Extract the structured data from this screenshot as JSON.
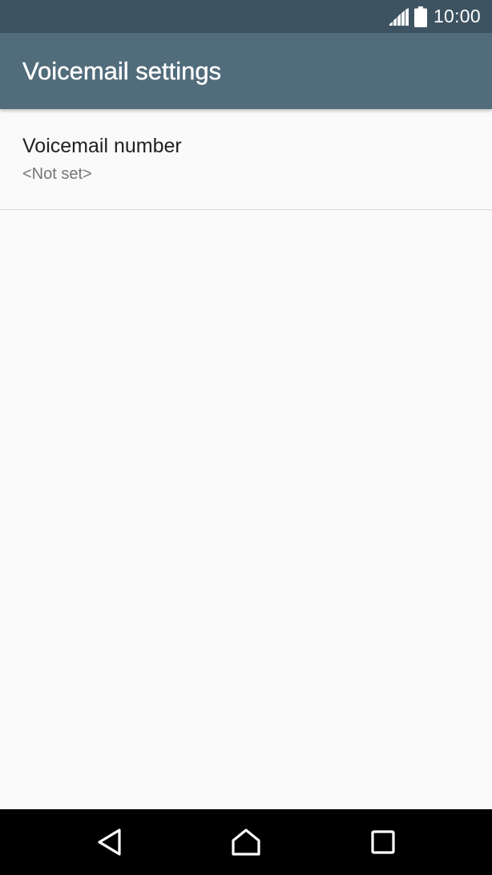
{
  "status_bar": {
    "time": "10:00",
    "icons": [
      "signal-icon",
      "battery-icon"
    ]
  },
  "app_bar": {
    "title": "Voicemail settings"
  },
  "preferences": [
    {
      "title": "Voicemail number",
      "summary": "<Not set>"
    }
  ],
  "nav_bar": {
    "icons": [
      "back-icon",
      "home-icon",
      "recents-icon"
    ]
  },
  "colors": {
    "status_bar": "#3d5361",
    "app_bar": "#516c7b",
    "background": "#fafafa",
    "nav_bar": "#000000"
  }
}
